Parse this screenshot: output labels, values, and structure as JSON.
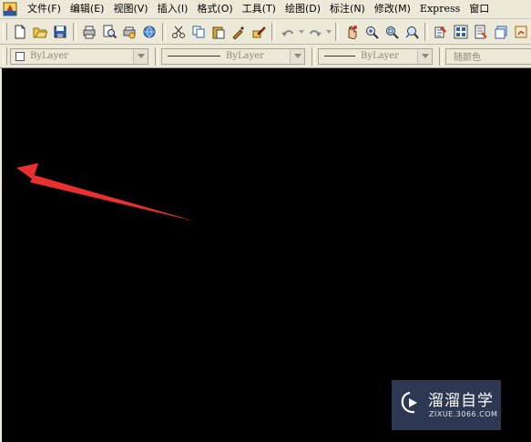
{
  "menubar": {
    "items": [
      {
        "label": "文件(F)"
      },
      {
        "label": "编辑(E)"
      },
      {
        "label": "视图(V)"
      },
      {
        "label": "插入(I)"
      },
      {
        "label": "格式(O)"
      },
      {
        "label": "工具(T)"
      },
      {
        "label": "绘图(D)"
      },
      {
        "label": "标注(N)"
      },
      {
        "label": "修改(M)"
      },
      {
        "label": "Express"
      },
      {
        "label": "窗口"
      }
    ]
  },
  "toolbar": {
    "icons": [
      "new-icon",
      "open-icon",
      "save-icon",
      "plot-icon",
      "plot-preview-icon",
      "publish-icon",
      "3d-dwf-icon",
      "cut-icon",
      "copy-icon",
      "paste-icon",
      "match-properties-icon",
      "block-editor-icon",
      "undo-icon",
      "redo-icon",
      "pan-icon",
      "zoom-realtime-icon",
      "zoom-window-icon",
      "zoom-previous-icon",
      "properties-icon",
      "design-center-icon",
      "tool-palettes-icon",
      "sheet-set-icon",
      "markup-icon"
    ]
  },
  "properties": {
    "color_value": "ByLayer",
    "linetype_value": "ByLayer",
    "lineweight_value": "ByLayer",
    "plotstyle_value": "随颜色"
  },
  "watermark": {
    "title": "溜溜自学",
    "url": "ZIXUE.3066.COM"
  },
  "colors": {
    "canvas": "#000000",
    "arrow": "#e8312f",
    "chrome": "#ece9d8"
  }
}
